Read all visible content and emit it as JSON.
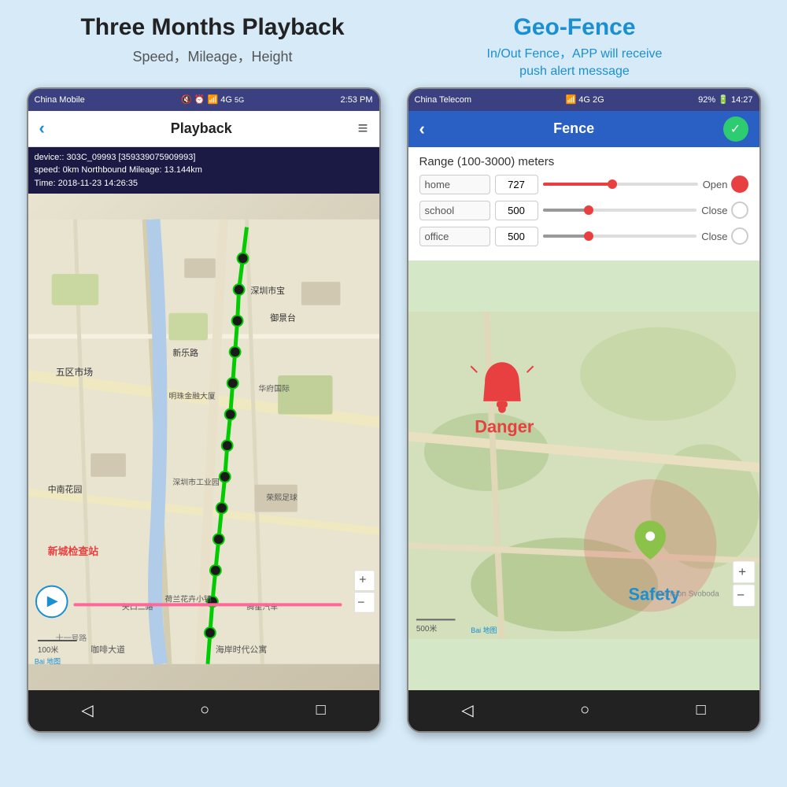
{
  "left_section": {
    "title": "Three Months Playback",
    "subtitle": "Speed，Mileage，Height"
  },
  "right_section": {
    "title": "Geo-Fence",
    "desc_line1": "In/Out Fence，APP will receive",
    "desc_line2": "push alert message"
  },
  "left_phone": {
    "status_bar": {
      "carrier": "China Mobile",
      "time": "2:53 PM",
      "icons": "🔇 ⏰ 📶 4G 56"
    },
    "nav": {
      "title": "Playback",
      "back_icon": "‹",
      "menu_icon": "≡"
    },
    "info": {
      "line1": "device::  303C_09993 [359339075909993]",
      "line2": "speed:  0km Northbound  Mileage: 13.144km",
      "line3": "Time:   2018-11-23  14:26:35"
    },
    "scale": "100米",
    "bottom_nav": [
      "◁",
      "○",
      "□"
    ]
  },
  "right_phone": {
    "status_bar": {
      "carrier": "China Telecom",
      "time": "14:27",
      "battery": "92%"
    },
    "nav": {
      "title": "Fence",
      "back_icon": "‹",
      "check_icon": "✓"
    },
    "fence_panel": {
      "range_title": "Range (100-3000) meters",
      "rows": [
        {
          "name": "home",
          "value": "727",
          "slider_pct": 45,
          "toggle": "Open",
          "on": true
        },
        {
          "name": "school",
          "value": "500",
          "slider_pct": 30,
          "toggle": "Close",
          "on": false
        },
        {
          "name": "office",
          "value": "500",
          "slider_pct": 30,
          "toggle": "Close",
          "on": false
        }
      ]
    },
    "map": {
      "danger_label": "Danger",
      "safety_label": "Safety",
      "scale": "500米",
      "pension_label": "Pension Svoboda",
      "zoom_plus": "+",
      "zoom_minus": "−"
    },
    "bottom_nav": [
      "◁",
      "○",
      "□"
    ]
  }
}
